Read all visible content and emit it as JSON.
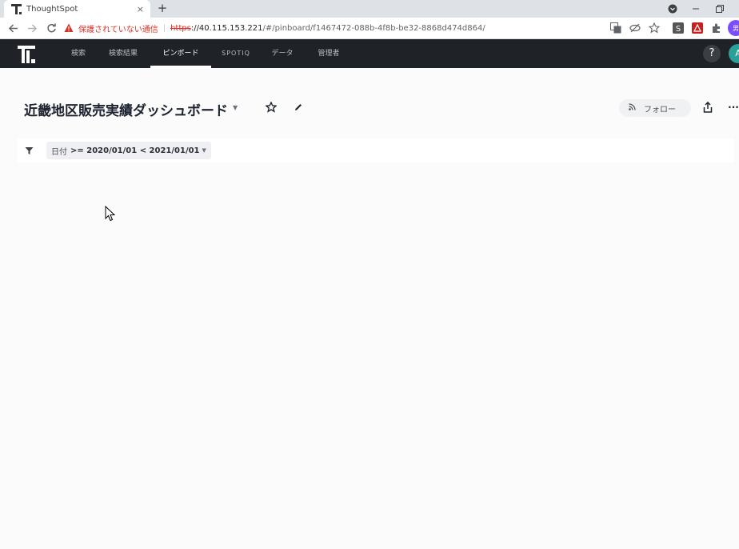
{
  "browser": {
    "tab_title": "ThoughtSpot",
    "tab_close": "×",
    "new_tab": "+",
    "security_warning": "保護されていない通信",
    "url_scheme": "https",
    "url_rest_host": "://40.115.153.221",
    "url_rest_path": "/#/pinboard/f1467472-088b-4f8b-be32-8868d474d864/",
    "profile_initial": "男"
  },
  "appnav": {
    "items": [
      {
        "label": "検索"
      },
      {
        "label": "検索結果"
      },
      {
        "label": "ピンボード"
      },
      {
        "label": "SPOTIQ"
      },
      {
        "label": "データ"
      },
      {
        "label": "管理者"
      }
    ],
    "help_label": "?",
    "avatar_initial": "A"
  },
  "pinboard": {
    "title": "近畿地区販売実績ダッシュボード",
    "follow_label": "フォロー",
    "more_label": "···"
  },
  "filter": {
    "field": "日付",
    "value": ">= 2020/01/01 < 2021/01/01"
  },
  "colors": {
    "nav_bg": "#1f2328",
    "page_bg": "#fbfbfc",
    "insecure_red": "#d93025",
    "avatar_teal": "#2aa198"
  }
}
